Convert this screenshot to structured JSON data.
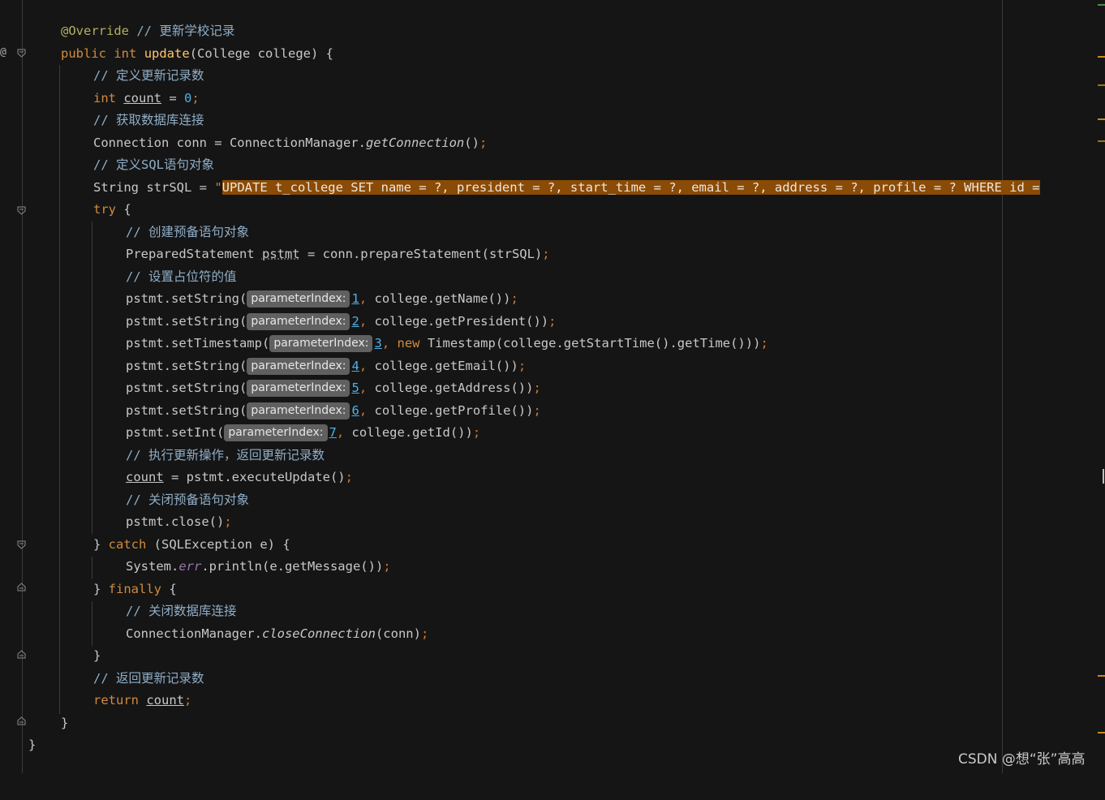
{
  "editor": {
    "gutter_marker": "@",
    "lines": {
      "l1": {
        "ann": "@Override",
        "cmt": " // 更新学校记录"
      },
      "l2": {
        "kw1": "public",
        "kw2": "int",
        "fn": "update",
        "rest": "(College college) {"
      },
      "l3": {
        "cmt": "// 定义更新记录数"
      },
      "l4": {
        "kw": "int",
        "var": "count",
        "eq": " = ",
        "num": "0",
        "semi": ";"
      },
      "l5": {
        "cmt": "// 获取数据库连接"
      },
      "l6": {
        "a": "Connection conn = ConnectionManager.",
        "method": "getConnection",
        "b": "()",
        "semi": ";"
      },
      "l7": {
        "cmt": "// 定义SQL语句对象"
      },
      "l8": {
        "a": "String strSQL = ",
        "q": "\"",
        "sql": "UPDATE t_college SET name = ?, president = ?, start_time = ?, email = ?, address = ?, profile = ? WHERE id ="
      },
      "l9": {
        "kw": "try",
        "rest": " {"
      },
      "l10": {
        "cmt": "// 创建预备语句对象"
      },
      "l11": {
        "a": "PreparedStatement ",
        "var": "pstmt",
        "b": " = conn.prepareStatement(strSQL)",
        "semi": ";"
      },
      "l12": {
        "cmt": "// 设置占位符的值"
      },
      "l13": {
        "a": "pstmt.setString(",
        "hint": "parameterIndex:",
        "num": "1",
        "comma": ",",
        "b": " college.getName())",
        "semi": ";"
      },
      "l14": {
        "a": "pstmt.setString(",
        "hint": "parameterIndex:",
        "num": "2",
        "comma": ",",
        "b": " college.getPresident())",
        "semi": ";"
      },
      "l15": {
        "a": "pstmt.setTimestamp(",
        "hint": "parameterIndex:",
        "num": "3",
        "comma": ",",
        "kw": " new",
        "b": " Timestamp(college.getStartTime().getTime()))",
        "semi": ";"
      },
      "l16": {
        "a": "pstmt.setString(",
        "hint": "parameterIndex:",
        "num": "4",
        "comma": ",",
        "b": " college.getEmail())",
        "semi": ";"
      },
      "l17": {
        "a": "pstmt.setString(",
        "hint": "parameterIndex:",
        "num": "5",
        "comma": ",",
        "b": " college.getAddress())",
        "semi": ";"
      },
      "l18": {
        "a": "pstmt.setString(",
        "hint": "parameterIndex:",
        "num": "6",
        "comma": ",",
        "b": " college.getProfile())",
        "semi": ";"
      },
      "l19": {
        "a": "pstmt.setInt(",
        "hint": "parameterIndex:",
        "num": "7",
        "comma": ",",
        "b": " college.getId())",
        "semi": ";"
      },
      "l20": {
        "cmt": "// 执行更新操作，返回更新记录数"
      },
      "l21": {
        "var": "count",
        "b": " = pstmt.executeUpdate()",
        "semi": ";"
      },
      "l22": {
        "cmt": "// 关闭预备语句对象"
      },
      "l23": {
        "a": "pstmt.close()",
        "semi": ";"
      },
      "l24": {
        "a": "} ",
        "kw": "catch",
        "b": " (SQLException e) {"
      },
      "l25": {
        "a": "System.",
        "field": "err",
        "b": ".println(e.getMessage())",
        "semi": ";"
      },
      "l26": {
        "a": "} ",
        "kw": "finally",
        "b": " {"
      },
      "l27": {
        "cmt": "// 关闭数据库连接"
      },
      "l28": {
        "a": "ConnectionManager.",
        "method": "closeConnection",
        "b": "(conn)",
        "semi": ";"
      },
      "l29": {
        "a": "}"
      },
      "l30": {
        "cmt": "// 返回更新记录数"
      },
      "l31": {
        "kw": "return",
        "sp": " ",
        "var": "count",
        "semi": ";"
      },
      "l32": {
        "a": "}"
      },
      "l33": {
        "a": "}"
      }
    }
  },
  "watermark": "CSDN @想“张”高高",
  "colors": {
    "background": "#151515",
    "keyword": "#d18b3d",
    "comment": "#8faec8",
    "annotation": "#b3ae60",
    "function": "#ffc66d",
    "number": "#4fb0e8",
    "string_highlight": "#8a4b06",
    "hint_background": "#606060"
  }
}
